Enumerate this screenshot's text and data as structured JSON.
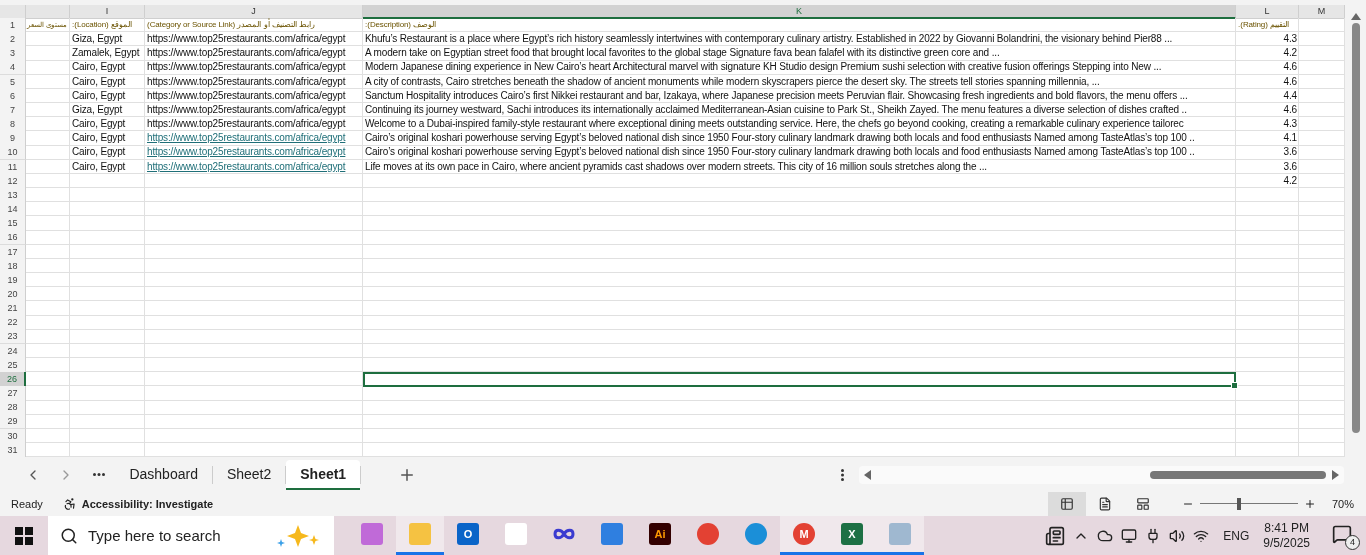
{
  "columns": [
    {
      "label": "I",
      "selected": false
    },
    {
      "label": "J",
      "selected": false
    },
    {
      "label": "K",
      "selected": true
    },
    {
      "label": "L",
      "selected": false
    },
    {
      "label": "M",
      "selected": false
    }
  ],
  "rows": [
    {
      "number": "1",
      "selected": false,
      "price_level": "مستوى السعر",
      "location": "الموقع (Location):",
      "link": {
        "text": "رابط التصنيف أو المصدر (Category or Source Link)",
        "kind": "header"
      },
      "description": "الوصف (Description):",
      "rating": "التقييم (Rating)."
    },
    {
      "number": "2",
      "selected": false,
      "location": "Giza, Egypt",
      "link": {
        "text": "https://www.top25restaurants.com/africa/egypt",
        "kind": "plain"
      },
      "description": "Khufu’s Restaurant is a place where Egypt’s rich history seamlessly intertwines with contemporary culinary artistry. Established in 2022 by Giovanni Bolandrini, the visionary behind Pier88 ...",
      "rating": "4.3"
    },
    {
      "number": "3",
      "selected": false,
      "location": "Zamalek, Egypt",
      "link": {
        "text": "https://www.top25restaurants.com/africa/egypt",
        "kind": "plain"
      },
      "description": "A modern take on Egyptian street food that brought local favorites to the global stage Signature fava bean falafel with its distinctive green core and ...",
      "rating": "4.2"
    },
    {
      "number": "4",
      "selected": false,
      "location": "Cairo, Egypt",
      "link": {
        "text": "https://www.top25restaurants.com/africa/egypt",
        "kind": "plain"
      },
      "description": "Modern Japanese dining experience in New Cairo’s heart Architectural marvel with signature KH Studio design Premium sushi selection with creative fusion offerings Stepping into New ...",
      "rating": "4.6"
    },
    {
      "number": "5",
      "selected": false,
      "location": "Cairo, Egypt",
      "link": {
        "text": "https://www.top25restaurants.com/africa/egypt",
        "kind": "plain"
      },
      "description": "A city of contrasts, Cairo stretches beneath the shadow of ancient monuments while modern skyscrapers pierce the desert sky. The streets tell stories spanning millennia, ...",
      "rating": "4.6"
    },
    {
      "number": "6",
      "selected": false,
      "location": "Cairo, Egypt",
      "link": {
        "text": "https://www.top25restaurants.com/africa/egypt",
        "kind": "plain"
      },
      "description": "Sanctum Hospitality introduces Cairo’s first Nikkei restaurant and bar, Izakaya, where Japanese precision meets Peruvian flair. Showcasing fresh ingredients and bold flavors, the menu offers ...",
      "rating": "4.4"
    },
    {
      "number": "7",
      "selected": false,
      "location": "Giza, Egypt",
      "link": {
        "text": "https://www.top25restaurants.com/africa/egypt",
        "kind": "plain"
      },
      "description": "Continuing its journey westward, Sachi introduces its internationally acclaimed Mediterranean-Asian cuisine to Park St., Sheikh Zayed. The menu features a diverse selection of dishes crafted ..",
      "rating": "4.6"
    },
    {
      "number": "8",
      "selected": false,
      "location": "Cairo, Egypt",
      "link": {
        "text": "https://www.top25restaurants.com/africa/egypt",
        "kind": "plain"
      },
      "description": "Welcome to a Dubai-inspired family-style restaurant where exceptional dining meets outstanding service. Here, the chefs go beyond cooking, creating a remarkable culinary experience tailorec",
      "rating": "4.3"
    },
    {
      "number": "9",
      "selected": false,
      "location": "Cairo, Egypt",
      "link": {
        "text": "https://www.top25restaurants.com/africa/egypt",
        "kind": "link"
      },
      "description": "Cairo’s original koshari powerhouse serving Egypt’s beloved national dish since 1950 Four-story culinary landmark drawing both locals and food enthusiasts Named among TasteAtlas’s top 100 ..",
      "rating": "4.1"
    },
    {
      "number": "10",
      "selected": false,
      "location": "Cairo, Egypt",
      "link": {
        "text": "https://www.top25restaurants.com/africa/egypt",
        "kind": "link"
      },
      "description": "Cairo’s original koshari powerhouse serving Egypt’s beloved national dish since 1950 Four-story culinary landmark drawing both locals and food enthusiasts Named among TasteAtlas’s top 100 ..",
      "rating": "3.6"
    },
    {
      "number": "11",
      "selected": false,
      "location": "Cairo, Egypt",
      "link": {
        "text": "https://www.top25restaurants.com/africa/egypt",
        "kind": "link"
      },
      "description": "Life moves at its own pace in Cairo, where ancient pyramids cast shadows over modern streets. This city of 16 million souls stretches along the ...",
      "rating": "3.6"
    },
    {
      "number": "12",
      "selected": false,
      "rating": "4.2"
    },
    {
      "number": "13",
      "selected": false
    },
    {
      "number": "14",
      "selected": false
    },
    {
      "number": "15",
      "selected": false
    },
    {
      "number": "16",
      "selected": false
    },
    {
      "number": "17",
      "selected": false
    },
    {
      "number": "18",
      "selected": false
    },
    {
      "number": "19",
      "selected": false
    },
    {
      "number": "20",
      "selected": false
    },
    {
      "number": "21",
      "selected": false
    },
    {
      "number": "22",
      "selected": false
    },
    {
      "number": "23",
      "selected": false
    },
    {
      "number": "24",
      "selected": false
    },
    {
      "number": "25",
      "selected": false
    },
    {
      "number": "26",
      "selected": true
    },
    {
      "number": "27",
      "selected": false
    },
    {
      "number": "28",
      "selected": false
    },
    {
      "number": "29",
      "selected": false
    },
    {
      "number": "30",
      "selected": false
    },
    {
      "number": "31",
      "selected": false
    }
  ],
  "sheet_tabs": [
    {
      "label": "Dashboard",
      "selected": false
    },
    {
      "label": "Sheet2",
      "selected": false
    },
    {
      "label": "Sheet1",
      "selected": true
    }
  ],
  "status_bar": {
    "status": "Ready",
    "accessibility": "Accessibility: Investigate",
    "views": [
      {
        "kind": "normal",
        "selected": true
      },
      {
        "kind": "page_layout",
        "selected": false
      },
      {
        "kind": "page_break",
        "selected": false
      }
    ],
    "zoom": {
      "level": 0.4,
      "reading": "70%"
    }
  },
  "taskbar": {
    "search": {
      "placeholder": "Type here to search"
    },
    "apps": [
      {
        "kind": "copilot",
        "running": false
      },
      {
        "kind": "folder",
        "running": true
      },
      {
        "kind": "outlook",
        "label": "O",
        "running": false
      },
      {
        "kind": "cards",
        "running": false
      },
      {
        "kind": "loop",
        "running": false
      },
      {
        "kind": "blue",
        "running": false
      },
      {
        "kind": "illustrator",
        "label": "Ai",
        "running": false
      },
      {
        "kind": "chrome",
        "running": false
      },
      {
        "kind": "edge",
        "running": false
      },
      {
        "kind": "chrome",
        "label": "M",
        "running": true
      },
      {
        "kind": "excel",
        "label": "X",
        "running": true
      },
      {
        "kind": "window",
        "running": true
      }
    ],
    "language": "ENG",
    "time": "8:41 PM",
    "date": "9/5/2025",
    "notifications": "4"
  }
}
